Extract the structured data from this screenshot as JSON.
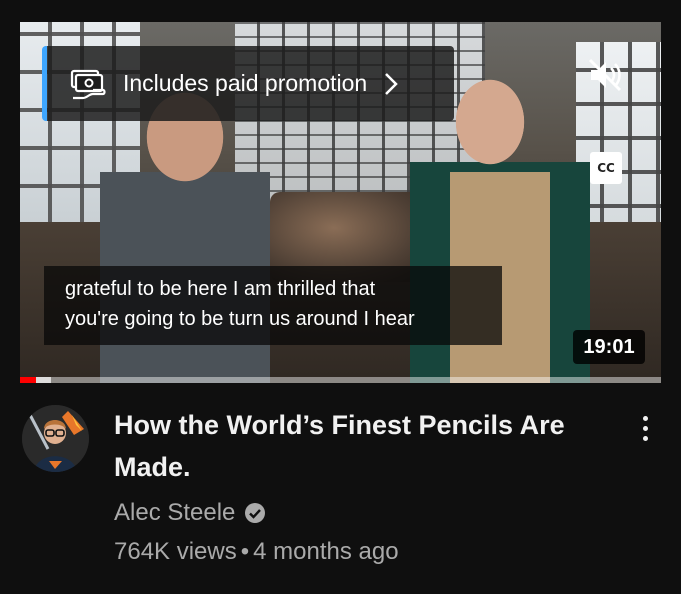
{
  "video": {
    "promo_text": "Includes paid promotion",
    "captions": [
      "grateful to be here I am thrilled that",
      "you're going to be turn us around I hear"
    ],
    "cc_label": "CC",
    "duration": "19:01",
    "progress_fraction": 0.025,
    "buffered_fraction": 0.048,
    "progress_color": "#ff0000",
    "promo_accent_color": "#3ea6ff",
    "icons": {
      "promo": "paid-promotion-icon",
      "promo_chevron": "chevron-right-icon",
      "mute": "volume-muted-icon",
      "cc": "closed-captions-icon"
    }
  },
  "meta": {
    "title": "How the World’s Finest Pencils Are Made.",
    "channel": "Alec Steele",
    "verified_icon": "verified-check-icon",
    "views": "764K views",
    "separator": "•",
    "age": "4 months ago",
    "menu_icon": "more-vert-icon"
  }
}
